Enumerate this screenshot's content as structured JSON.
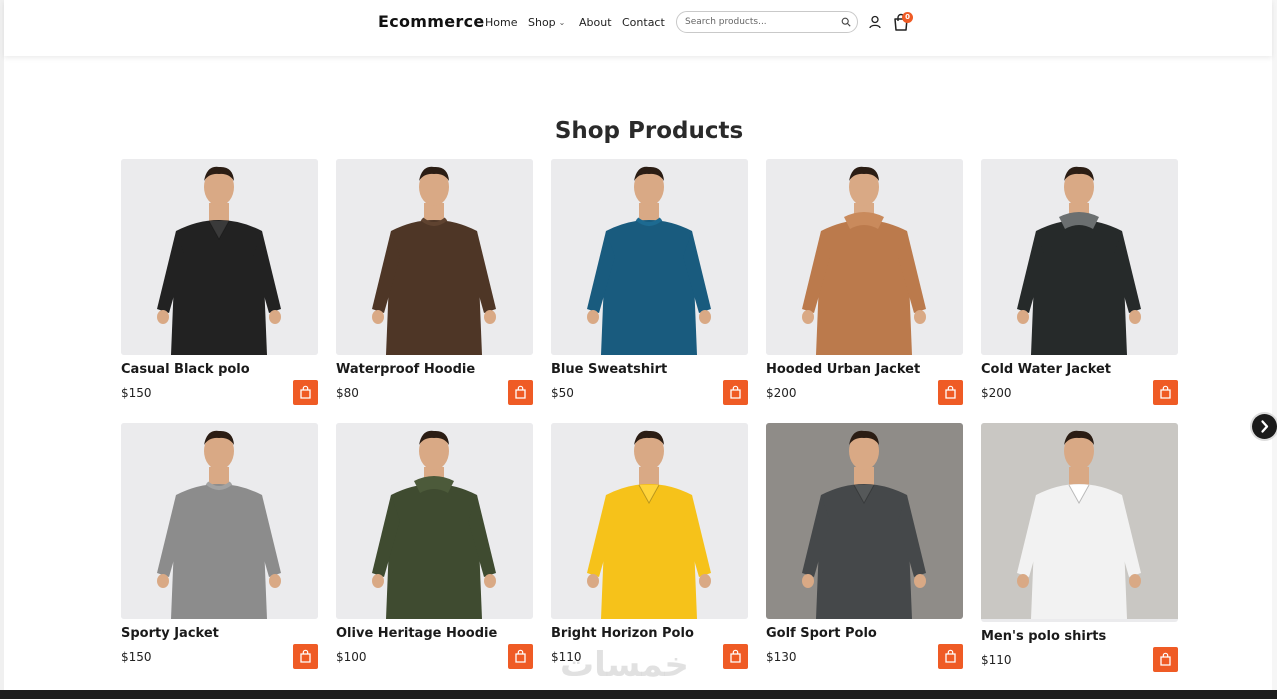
{
  "header": {
    "brand": "Ecommerce",
    "nav": [
      "Home",
      "Shop",
      "About",
      "Contact"
    ],
    "search_placeholder": "Search products...",
    "cart_count": "0"
  },
  "page_title": "Shop Products",
  "products": [
    {
      "name": "Casual Black polo",
      "price": "$150",
      "garment": "#222222",
      "accent": "#3a3a3a",
      "bg": "#ebebed"
    },
    {
      "name": "Waterproof Hoodie",
      "price": "$80",
      "garment": "#4e3626",
      "accent": "#5f4330",
      "bg": "#ebebed"
    },
    {
      "name": "Blue Sweatshirt",
      "price": "$50",
      "garment": "#195b7e",
      "accent": "#1d6a91",
      "bg": "#ebebed"
    },
    {
      "name": "Hooded Urban Jacket",
      "price": "$200",
      "garment": "#bb7a4c",
      "accent": "#c98a5c",
      "bg": "#ebebed"
    },
    {
      "name": "Cold Water Jacket",
      "price": "$200",
      "garment": "#262a2a",
      "accent": "#6b6f70",
      "bg": "#ebebed"
    },
    {
      "name": "Sporty Jacket",
      "price": "$150",
      "garment": "#8c8c8c",
      "accent": "#a2a2a2",
      "bg": "#ebebed"
    },
    {
      "name": "Olive Heritage Hoodie",
      "price": "$100",
      "garment": "#3f4b30",
      "accent": "#4c5a3a",
      "bg": "#ebebed"
    },
    {
      "name": "Bright Horizon Polo",
      "price": "$110",
      "garment": "#f6c21a",
      "accent": "#ffd43a",
      "bg": "#ebebed"
    },
    {
      "name": "Golf Sport Polo",
      "price": "$130",
      "garment": "#45484a",
      "accent": "#555859",
      "bg": "#8f8c88"
    },
    {
      "name": "Men's polo shirts",
      "price": "$110",
      "garment": "#f2f2f2",
      "accent": "#ffffff",
      "bg": "#c9c7c3"
    }
  ],
  "colors": {
    "accent": "#ef5b25",
    "text": "#1a1a1a"
  },
  "watermark": "خمسات"
}
